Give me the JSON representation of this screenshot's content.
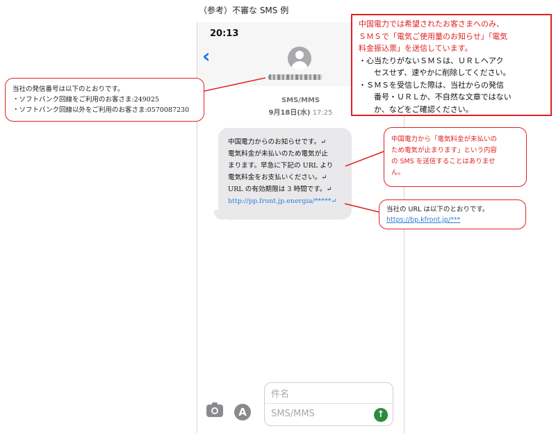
{
  "caption": "（参考）不審な SMS 例",
  "phone": {
    "status_time": "20:13",
    "back_glyph": "‹",
    "sender_label": "SMS/MMS",
    "date": "9月18日(水)",
    "time": "17:25",
    "message_lines": [
      "中国電力からのお知らせです。↵",
      "電気料金が未払いのため電気が止",
      "まります。早急に下記の URL より",
      "電気料金をお支払いください。↵",
      "URL の有効期限は 3 時間です。↵"
    ],
    "message_url": "http://pp.front.jp.energia/*****↵",
    "input_title": "件名",
    "input_placeholder": "SMS/MMS",
    "icons": [
      "camera-icon",
      "app-store-icon",
      "send-arrow-icon",
      "person-avatar-icon",
      "back-chevron-icon"
    ],
    "bubble_color": "#e9e9eb",
    "send_color": "#2e8b3e"
  },
  "notes": {
    "left": [
      "当社の発信番号は以下のとおりです。",
      "・ソフトバンク回線をご利用のお客さま:249025",
      "・ソフトバンク回線以外をご利用のお客さま:0570087230"
    ],
    "top_red": [
      "中国電力では希望されたお客さまへのみ、",
      "ＳＭＳで「電気ご使用量のお知らせ」「電気",
      "料金振込票」を送信しています。"
    ],
    "top_bullets": [
      "・心当たりがないＳＭＳは、ＵＲＬへアク",
      "セスせず、速やかに削除してください。",
      "・ＳＭＳを受信した際は、当社からの発信",
      "番号・ＵＲＬか、不自然な文章ではない",
      "か、などをご確認ください。"
    ],
    "mid": [
      "中国電力から「電気料金が未払いの",
      "ため電気が止まります」という内容",
      "の SMS を送信することはありませ",
      "ん。"
    ],
    "bottom_text": "当社の URL は以下のとおりです。",
    "bottom_url": "https://bp.kfront.jp/***"
  },
  "colors": {
    "callout_border": "#e02020",
    "link": "#2d7cd6"
  }
}
